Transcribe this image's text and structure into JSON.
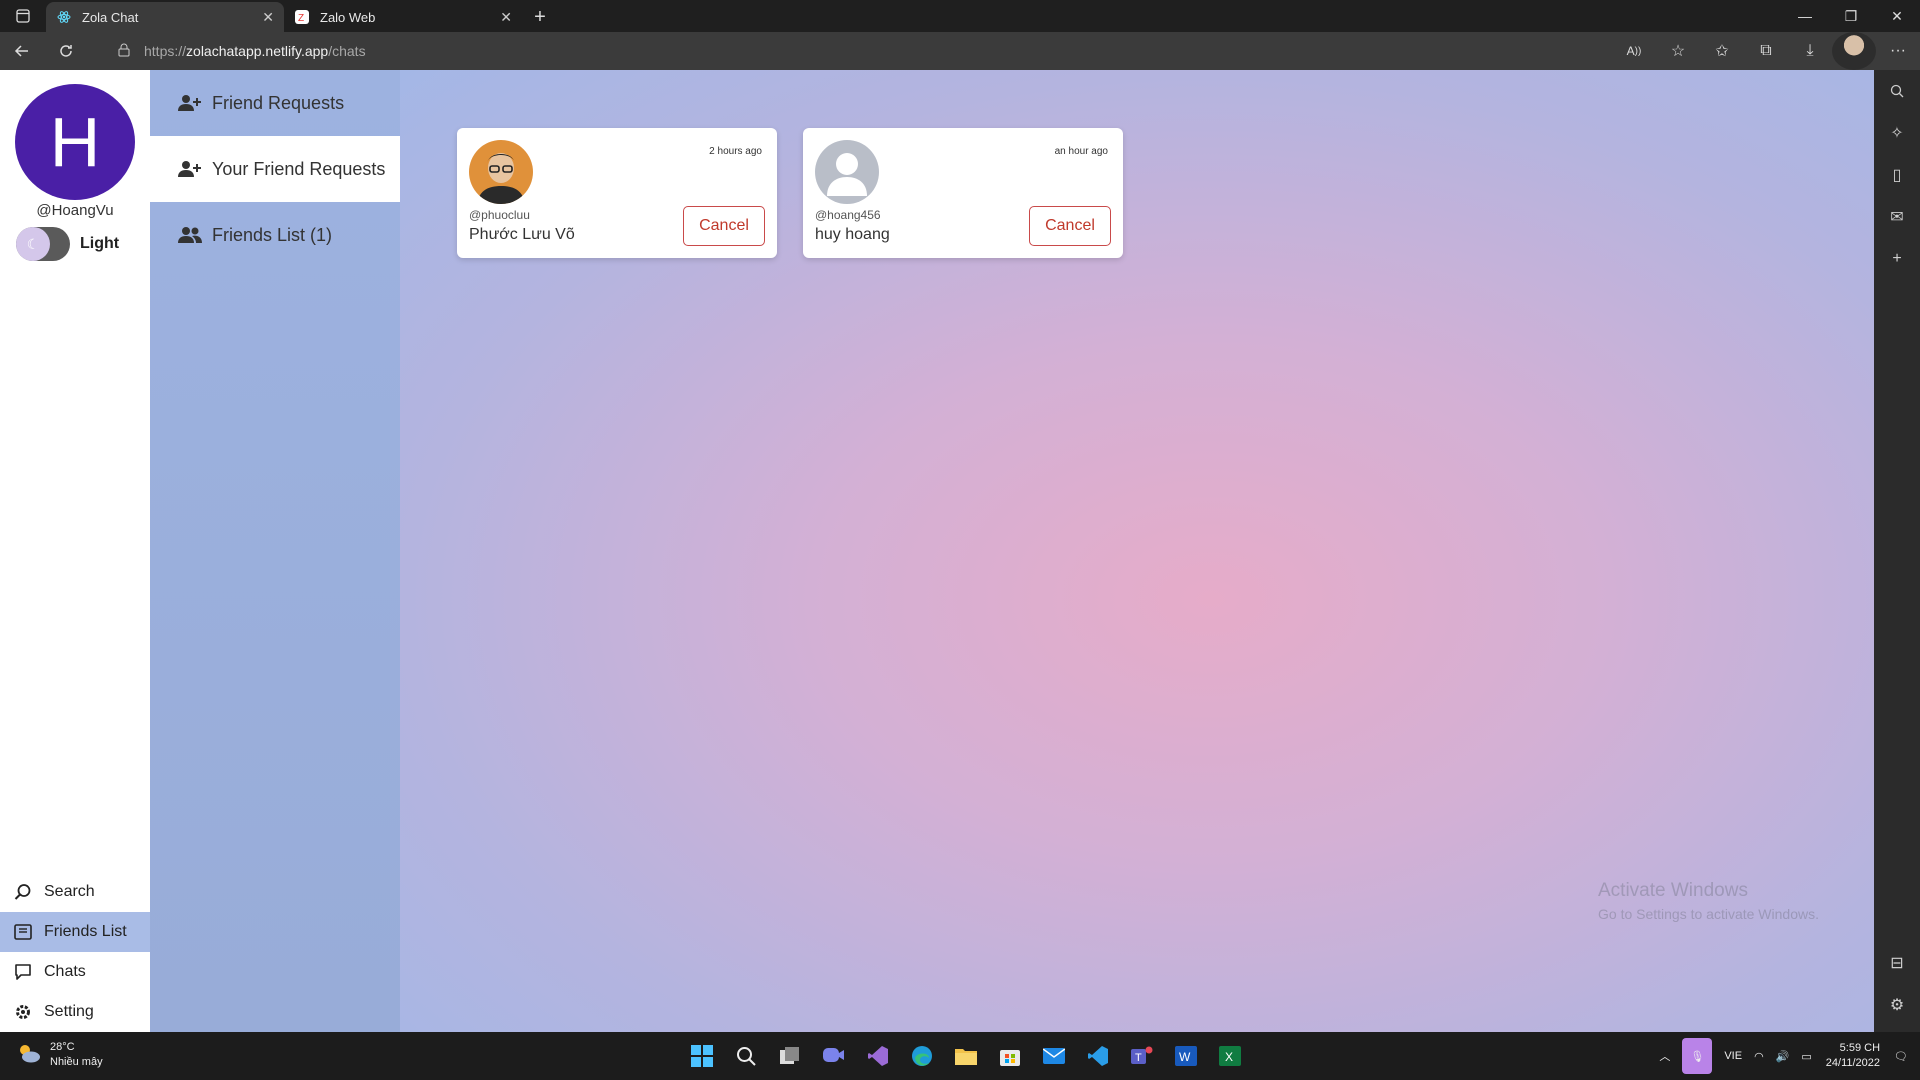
{
  "browser": {
    "tabs": [
      {
        "title": "Zola Chat",
        "active": true
      },
      {
        "title": "Zalo Web",
        "active": false
      }
    ],
    "url_scheme": "https://",
    "url_host": "zolachatapp.netlify.app",
    "url_path": "/chats"
  },
  "profile": {
    "initial": "H",
    "username": "@HoangVu",
    "theme_label": "Light",
    "avatar_color": "#4a1fa6"
  },
  "nav": {
    "items": [
      {
        "label": "Search",
        "icon": "search-icon"
      },
      {
        "label": "Friends List",
        "icon": "address-book-icon",
        "active": true
      },
      {
        "label": "Chats",
        "icon": "chat-bubble-icon"
      },
      {
        "label": "Setting",
        "icon": "gear-icon"
      }
    ]
  },
  "subnav": {
    "items": [
      {
        "label": "Friend Requests",
        "icon": "user-plus-icon"
      },
      {
        "label": "Your Friend Requests",
        "icon": "user-plus-icon",
        "active": true
      },
      {
        "label": "Friends List (1)",
        "icon": "users-icon"
      }
    ]
  },
  "requests": [
    {
      "handle": "@phuocluu",
      "name": "Phước Lưu Võ",
      "time": "2 hours ago",
      "action": "Cancel",
      "avatar": "photo"
    },
    {
      "handle": "@hoang456",
      "name": "huy hoang",
      "time": "an hour ago",
      "action": "Cancel",
      "avatar": "default-user-icon"
    }
  ],
  "watermark": {
    "line1": "Activate Windows",
    "line2": "Go to Settings to activate Windows."
  },
  "taskbar": {
    "temp": "28°C",
    "weather": "Nhiều mây",
    "lang": "VIE",
    "time": "5:59 CH",
    "date": "24/11/2022"
  }
}
